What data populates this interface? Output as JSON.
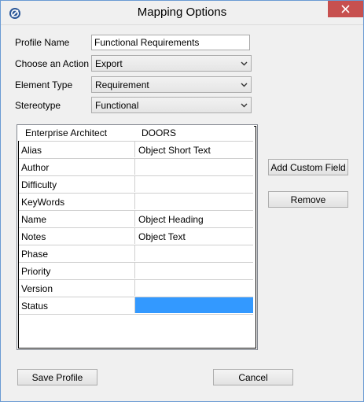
{
  "window": {
    "title": "Mapping Options",
    "accent": "#c7504f"
  },
  "form": {
    "profile_name_label": "Profile Name",
    "profile_name_value": "Functional Requirements",
    "action_label": "Choose an Action",
    "action_value": "Export",
    "element_type_label": "Element Type",
    "element_type_value": "Requirement",
    "stereotype_label": "Stereotype",
    "stereotype_value": "Functional"
  },
  "grid": {
    "headers": [
      "Enterprise Architect",
      "DOORS"
    ],
    "rows": [
      {
        "ea": "Alias",
        "doors": "Object Short Text"
      },
      {
        "ea": "Author",
        "doors": ""
      },
      {
        "ea": "Difficulty",
        "doors": ""
      },
      {
        "ea": "KeyWords",
        "doors": ""
      },
      {
        "ea": "Name",
        "doors": "Object Heading"
      },
      {
        "ea": "Notes",
        "doors": "Object Text"
      },
      {
        "ea": "Phase",
        "doors": ""
      },
      {
        "ea": "Priority",
        "doors": ""
      },
      {
        "ea": "Version",
        "doors": ""
      },
      {
        "ea": "Status",
        "doors": ""
      }
    ],
    "selection_color": "#3399ff"
  },
  "buttons": {
    "add_custom_field": "Add Custom Field",
    "remove": "Remove",
    "save_profile": "Save Profile",
    "cancel": "Cancel"
  }
}
